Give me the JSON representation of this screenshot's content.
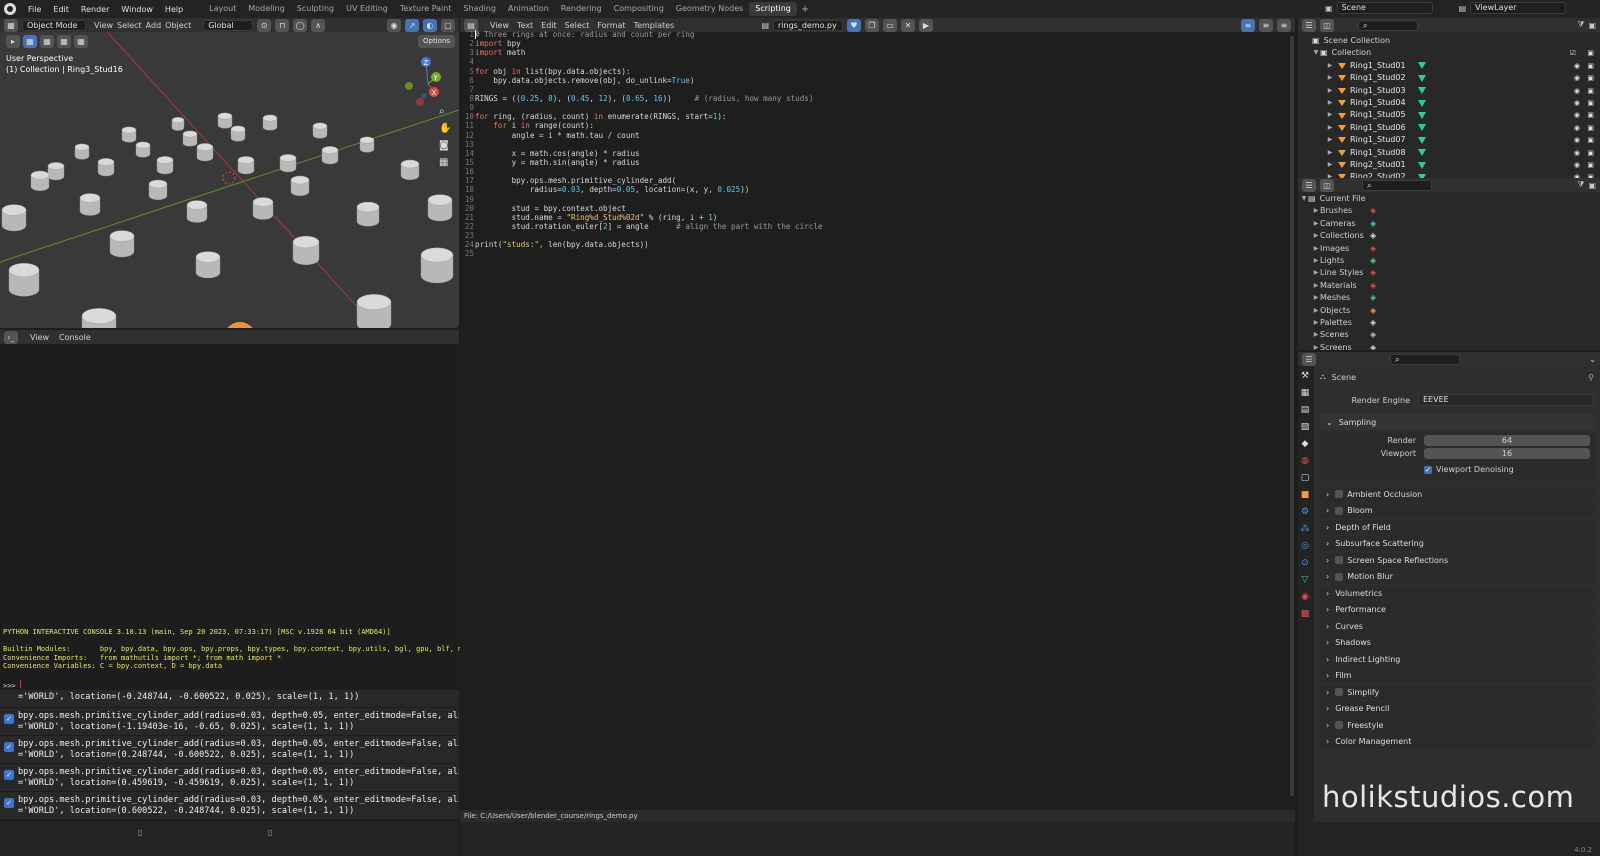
{
  "menubar": {
    "items": [
      "File",
      "Edit",
      "Render",
      "Window",
      "Help"
    ]
  },
  "workspaces": {
    "tabs": [
      "Layout",
      "Modeling",
      "Sculpting",
      "UV Editing",
      "Texture Paint",
      "Shading",
      "Animation",
      "Rendering",
      "Compositing",
      "Geometry Nodes",
      "Scripting"
    ],
    "active": "Scripting"
  },
  "scene_field": "Scene",
  "viewlayer_field": "ViewLayer",
  "viewport": {
    "mode": "Object Mode",
    "menus": [
      "View",
      "Select",
      "Add",
      "Object"
    ],
    "orientation": "Global",
    "options": "Options",
    "overlay_line1": "User Perspective",
    "overlay_line2": "(1) Collection | Ring3_Stud16"
  },
  "text_editor": {
    "menus": [
      "View",
      "Text",
      "Edit",
      "Select",
      "Format",
      "Templates"
    ],
    "filename": "rings_demo.py",
    "footer": "File: C:/Users/User/blender_course/rings_demo.py",
    "lines": [
      [
        {
          "t": "# Three rings at once: radius and count per ring",
          "c": "cm"
        }
      ],
      [
        {
          "t": "import",
          "c": "kw"
        },
        {
          "t": " bpy",
          "c": "n"
        }
      ],
      [
        {
          "t": "import",
          "c": "kw"
        },
        {
          "t": " math",
          "c": "n"
        }
      ],
      [],
      [
        {
          "t": "for",
          "c": "kw"
        },
        {
          "t": " obj ",
          "c": "n"
        },
        {
          "t": "in",
          "c": "kw"
        },
        {
          "t": " list(bpy.data.objects):",
          "c": "n"
        }
      ],
      [
        {
          "t": "    bpy.data.objects.remove(obj, do_unlink=",
          "c": "n"
        },
        {
          "t": "True",
          "c": "bi"
        },
        {
          "t": ")",
          "c": "n"
        }
      ],
      [],
      [
        {
          "t": "RINGS = ((",
          "c": "n"
        },
        {
          "t": "0.25",
          "c": "nu"
        },
        {
          "t": ", ",
          "c": "n"
        },
        {
          "t": "8",
          "c": "nu"
        },
        {
          "t": "), (",
          "c": "n"
        },
        {
          "t": "0.45",
          "c": "nu"
        },
        {
          "t": ", ",
          "c": "n"
        },
        {
          "t": "12",
          "c": "nu"
        },
        {
          "t": "), (",
          "c": "n"
        },
        {
          "t": "0.65",
          "c": "nu"
        },
        {
          "t": ", ",
          "c": "n"
        },
        {
          "t": "16",
          "c": "nu"
        },
        {
          "t": "))     ",
          "c": "n"
        },
        {
          "t": "# (radius, how many studs)",
          "c": "cm"
        }
      ],
      [],
      [
        {
          "t": "for",
          "c": "kw"
        },
        {
          "t": " ring, (radius, count) ",
          "c": "n"
        },
        {
          "t": "in",
          "c": "kw"
        },
        {
          "t": " enumerate(RINGS, start=",
          "c": "n"
        },
        {
          "t": "1",
          "c": "nu"
        },
        {
          "t": "):",
          "c": "n"
        }
      ],
      [
        {
          "t": "    ",
          "c": "n"
        },
        {
          "t": "for",
          "c": "kw"
        },
        {
          "t": " i ",
          "c": "n"
        },
        {
          "t": "in",
          "c": "kw"
        },
        {
          "t": " range(count):",
          "c": "n"
        }
      ],
      [
        {
          "t": "        angle = i * math.tau / count",
          "c": "n"
        }
      ],
      [],
      [
        {
          "t": "        x = math.cos(angle) * radius",
          "c": "n"
        }
      ],
      [
        {
          "t": "        y = math.sin(angle) * radius",
          "c": "n"
        }
      ],
      [],
      [
        {
          "t": "        bpy.ops.mesh.primitive_cylinder_add(",
          "c": "n"
        }
      ],
      [
        {
          "t": "            radius=",
          "c": "n"
        },
        {
          "t": "0.03",
          "c": "nu"
        },
        {
          "t": ", depth=",
          "c": "n"
        },
        {
          "t": "0.05",
          "c": "nu"
        },
        {
          "t": ", location=(x, y, ",
          "c": "n"
        },
        {
          "t": "0.025",
          "c": "nu"
        },
        {
          "t": "))",
          "c": "n"
        }
      ],
      [],
      [
        {
          "t": "        stud = bpy.context.object",
          "c": "n"
        }
      ],
      [
        {
          "t": "        stud.name = ",
          "c": "n"
        },
        {
          "t": "\"Ring%d_Stud%02d\"",
          "c": "st"
        },
        {
          "t": " % (ring, i + ",
          "c": "n"
        },
        {
          "t": "1",
          "c": "nu"
        },
        {
          "t": ")",
          "c": "n"
        }
      ],
      [
        {
          "t": "        stud.rotation_euler[",
          "c": "n"
        },
        {
          "t": "2",
          "c": "nu"
        },
        {
          "t": "] = angle      ",
          "c": "n"
        },
        {
          "t": "# align the part with the circle",
          "c": "cm"
        }
      ],
      [],
      [
        {
          "t": "print(",
          "c": "n"
        },
        {
          "t": "\"studs:\"",
          "c": "st"
        },
        {
          "t": ", len(bpy.data.objects))",
          "c": "n"
        }
      ],
      []
    ]
  },
  "console": {
    "menus": [
      "View",
      "Console"
    ],
    "banner": "PYTHON INTERACTIVE CONSOLE 3.10.13 (main, Sep 20 2023, 07:33:17) [MSC v.1928 64 bit (AMD64)]",
    "builtin": "Builtin Modules:       bpy, bpy.data, bpy.ops, bpy.props, bpy.types, bpy.context, bpy.utils, bgl, gpu, blf, mathutils",
    "imports": "Convenience Imports:   from mathutils import *; from math import *",
    "variables": "Convenience Variables: C = bpy.context, D = bpy.data",
    "prompt": ">>> "
  },
  "info_log": [
    {
      "l1": "='WORLD', location=(-0.248744, -0.600522, 0.025), scale=(1, 1, 1))",
      "l2": "",
      "partial": true
    },
    {
      "l1": "bpy.ops.mesh.primitive_cylinder_add(radius=0.03, depth=0.05, enter_editmode=False, align",
      "l2": "='WORLD', location=(-1.19403e-16, -0.65, 0.025), scale=(1, 1, 1))"
    },
    {
      "l1": "bpy.ops.mesh.primitive_cylinder_add(radius=0.03, depth=0.05, enter_editmode=False, align",
      "l2": "='WORLD', location=(0.248744, -0.600522, 0.025), scale=(1, 1, 1))"
    },
    {
      "l1": "bpy.ops.mesh.primitive_cylinder_add(radius=0.03, depth=0.05, enter_editmode=False, align",
      "l2": "='WORLD', location=(0.459619, -0.459619, 0.025), scale=(1, 1, 1))"
    },
    {
      "l1": "bpy.ops.mesh.primitive_cylinder_add(radius=0.03, depth=0.05, enter_editmode=False, align",
      "l2": "='WORLD', location=(0.600522, -0.248744, 0.025), scale=(1, 1, 1))"
    }
  ],
  "outliner": {
    "root": "Scene Collection",
    "collection": "Collection",
    "items": [
      "Ring1_Stud01",
      "Ring1_Stud02",
      "Ring1_Stud03",
      "Ring1_Stud04",
      "Ring1_Stud05",
      "Ring1_Stud06",
      "Ring1_Stud07",
      "Ring1_Stud08",
      "Ring2_Stud01",
      "Ring2_Stud02"
    ]
  },
  "blendfile": {
    "root": "Current File",
    "items": [
      "Brushes",
      "Cameras",
      "Collections",
      "Images",
      "Lights",
      "Line Styles",
      "Materials",
      "Meshes",
      "Objects",
      "Palettes",
      "Scenes",
      "Screens"
    ]
  },
  "properties": {
    "title": "Scene",
    "render_engine_label": "Render Engine",
    "render_engine": "EEVEE",
    "sampling": "Sampling",
    "render_label": "Render",
    "render_value": "64",
    "viewport_label": "Viewport",
    "viewport_value": "16",
    "denoise": "Viewport Denoising",
    "panels": [
      {
        "n": "Ambient Occlusion",
        "c": true
      },
      {
        "n": "Bloom",
        "c": true
      },
      {
        "n": "Depth of Field",
        "c": false
      },
      {
        "n": "Subsurface Scattering",
        "c": false
      },
      {
        "n": "Screen Space Reflections",
        "c": true
      },
      {
        "n": "Motion Blur",
        "c": true
      },
      {
        "n": "Volumetrics",
        "c": false
      },
      {
        "n": "Performance",
        "c": false
      },
      {
        "n": "Curves",
        "c": false
      },
      {
        "n": "Shadows",
        "c": false
      },
      {
        "n": "Indirect Lighting",
        "c": false
      },
      {
        "n": "Film",
        "c": false
      },
      {
        "n": "Simplify",
        "c": true
      },
      {
        "n": "Grease Pencil",
        "c": false
      },
      {
        "n": "Freestyle",
        "c": true
      },
      {
        "n": "Color Management",
        "c": false
      }
    ]
  },
  "watermark": "holikstudios.com",
  "version": "4.0.2",
  "syntax_colors": {
    "kw": "#e07a5f",
    "n": "#d8d8d8",
    "nu": "#5ec8f0",
    "st": "#f0c674",
    "cm": "#9a9a9a",
    "bi": "#5ec8f0"
  }
}
